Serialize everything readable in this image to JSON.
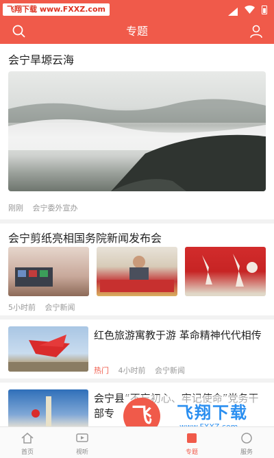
{
  "status_bar": {
    "watermark_text": "飞翔下载 www.FXXZ.com",
    "icons": [
      "signal-icon",
      "wifi-icon",
      "battery-icon"
    ]
  },
  "header": {
    "title": "专题",
    "left_icon": "search-icon",
    "right_icon": "user-icon",
    "bg_color": "#f05a4a"
  },
  "feed": {
    "big_card": {
      "title": "会宁旱塬云海",
      "meta": [
        "刚刚",
        "会宁委外宣办"
      ]
    },
    "three_card": {
      "title": "会宁剪纸亮相国务院新闻发布会",
      "meta": [
        "5小时前",
        "会宁新闻"
      ]
    },
    "row_cards": [
      {
        "title": "红色旅游寓教于游 革命精神代代相传",
        "tag": "热门",
        "meta": [
          "4小时前",
          "会宁新闻"
        ]
      },
      {
        "title": "会宁县“不忘初心、牢记使命”党务干部专",
        "tag": "",
        "meta": []
      }
    ]
  },
  "overlay_watermark": {
    "logo_char": "飞",
    "text": "飞翔下载",
    "url": "www.FXXZ.com"
  },
  "tabbar": {
    "tabs": [
      {
        "label": "首页",
        "icon": "home-icon",
        "active": false
      },
      {
        "label": "视听",
        "icon": "video-icon",
        "active": false
      },
      {
        "label": "",
        "icon": "",
        "active": false
      },
      {
        "label": "专题",
        "icon": "topic-icon",
        "active": true
      },
      {
        "label": "服务",
        "icon": "service-icon",
        "active": false
      }
    ]
  }
}
